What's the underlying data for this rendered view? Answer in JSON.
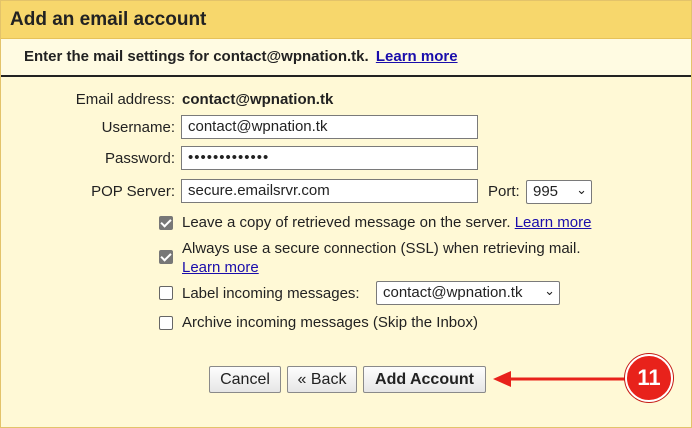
{
  "dialog": {
    "title": "Add an email account",
    "instruction": "Enter the mail settings for contact@wpnation.tk.",
    "learn_more": "Learn more"
  },
  "form": {
    "email_label": "Email address:",
    "email_value": "contact@wpnation.tk",
    "username_label": "Username:",
    "username_value": "contact@wpnation.tk",
    "password_label": "Password:",
    "password_value": "•••••••••••••",
    "pop_label": "POP Server:",
    "pop_value": "secure.emailsrvr.com",
    "port_label": "Port:",
    "port_value": "995"
  },
  "options": [
    {
      "label": "Leave a copy of retrieved message on the server.",
      "link": "Learn more",
      "checked": true
    },
    {
      "label": "Always use a secure connection (SSL) when retrieving mail.",
      "link": "Learn more",
      "checked": true
    },
    {
      "label": "Label incoming messages:",
      "select_value": "contact@wpnation.tk",
      "checked": false
    },
    {
      "label": "Archive incoming messages (Skip the Inbox)",
      "checked": false
    }
  ],
  "buttons": {
    "cancel": "Cancel",
    "back": "« Back",
    "add": "Add Account"
  },
  "annotation": {
    "step": "11",
    "color": "#e8221b"
  }
}
